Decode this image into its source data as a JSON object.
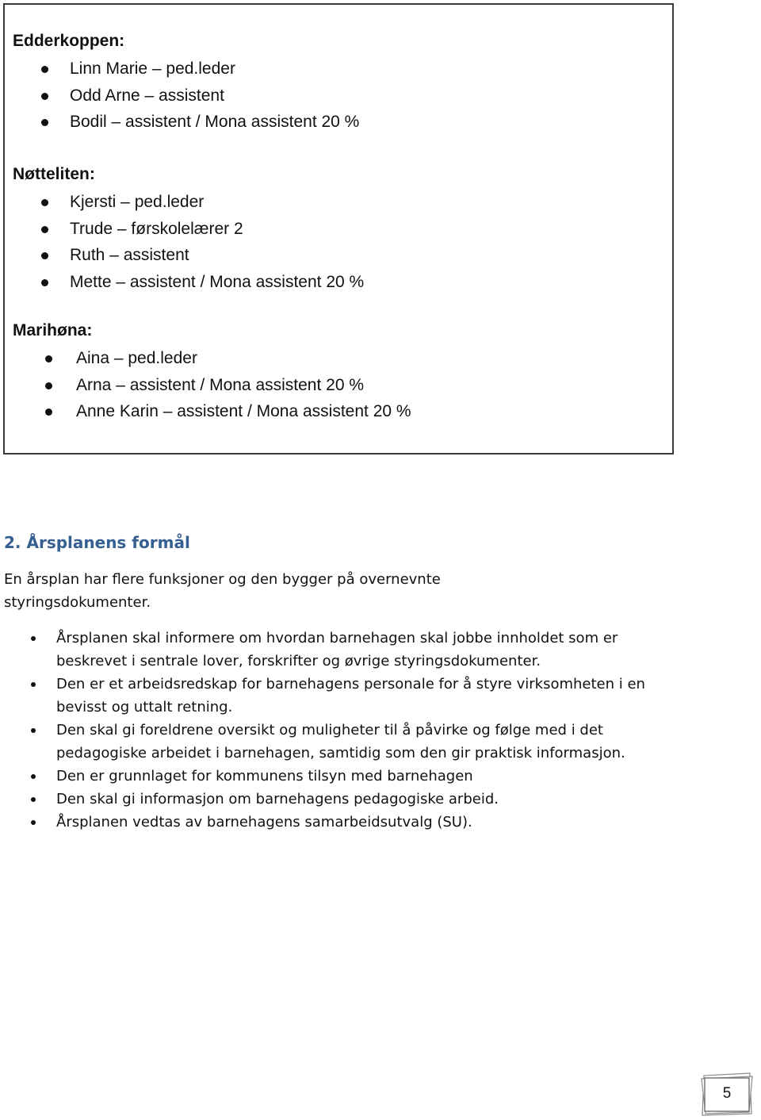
{
  "staff_box": {
    "groups": [
      {
        "title": "Edderkoppen:",
        "members": [
          "Linn Marie – ped.leder",
          "Odd Arne – assistent",
          "Bodil – assistent / Mona assistent 20 %"
        ]
      },
      {
        "title": "Nøtteliten:",
        "members": [
          "Kjersti – ped.leder",
          "Trude – førskolelærer 2",
          "Ruth – assistent",
          "Mette – assistent / Mona assistent 20 %"
        ]
      },
      {
        "title": "Marihøna:",
        "members": [
          "Aina – ped.leder",
          "Arna – assistent / Mona assistent 20 %",
          "Anne Karin – assistent / Mona assistent 20 %"
        ]
      }
    ]
  },
  "section": {
    "heading": "2. Årsplanens formål",
    "heading_color": "#365f91",
    "intro": "En årsplan har flere funksjoner og den bygger på overnevnte styringsdokumenter.",
    "items": [
      "Årsplanen skal informere om hvordan barnehagen skal jobbe innholdet som er beskrevet i sentrale lover, forskrifter og øvrige styringsdokumenter.",
      "Den er et arbeidsredskap for barnehagens personale for å styre virksomheten i en bevisst og uttalt retning.",
      "Den skal gi foreldrene oversikt og muligheter til å påvirke og følge med i det pedagogiske arbeidet i barnehagen, samtidig som den gir praktisk informasjon.",
      "Den er grunnlaget for kommunens tilsyn med barnehagen",
      "Den skal gi informasjon om barnehagens pedagogiske arbeid.",
      "Årsplanen vedtas av barnehagens samarbeidsutvalg (SU)."
    ]
  },
  "footer": {
    "page_number": "5"
  }
}
